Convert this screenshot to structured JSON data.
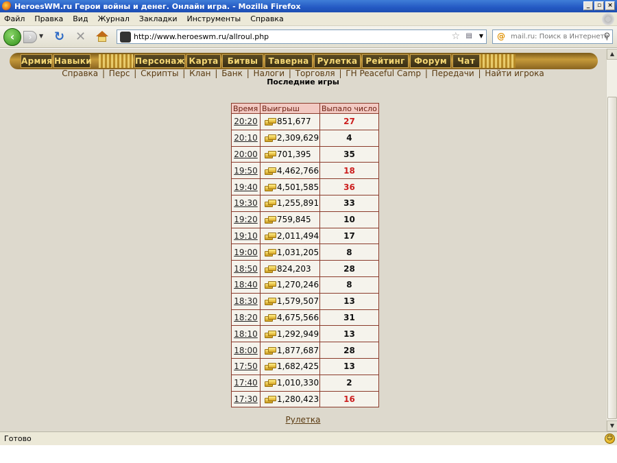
{
  "window": {
    "title": "HeroesWM.ru Герои войны и денег. Онлайн игра. - Mozilla Firefox",
    "buttons": [
      "_",
      "▫",
      "×"
    ]
  },
  "menubar": [
    "Файл",
    "Правка",
    "Вид",
    "Журнал",
    "Закладки",
    "Инструменты",
    "Справка"
  ],
  "toolbar": {
    "url": "http://www.heroeswm.ru/allroul.php",
    "search_placeholder": "mail.ru: Поиск в Интернете"
  },
  "game_menu": {
    "side_buttons": [
      "Армия",
      "Навыки"
    ],
    "main_buttons": [
      "Персонаж",
      "Карта",
      "Битвы",
      "Таверна",
      "Рулетка",
      "Рейтинг",
      "Форум",
      "Чат"
    ]
  },
  "sub_links": [
    "Справка",
    "Перс",
    "Скрипты",
    "Клан",
    "Банк",
    "Налоги",
    "Торговля",
    "ГН Peaceful Camp",
    "Передачи",
    "Найти игрока"
  ],
  "page_title": "Последние игры",
  "table": {
    "headers": [
      "Время",
      "Выигрыш",
      "Выпало число"
    ],
    "rows": [
      {
        "time": "20:20",
        "win": "851,677",
        "number": "27",
        "color": "red"
      },
      {
        "time": "20:10",
        "win": "2,309,629",
        "number": "4",
        "color": "black"
      },
      {
        "time": "20:00",
        "win": "701,395",
        "number": "35",
        "color": "black"
      },
      {
        "time": "19:50",
        "win": "4,462,766",
        "number": "18",
        "color": "red"
      },
      {
        "time": "19:40",
        "win": "4,501,585",
        "number": "36",
        "color": "red"
      },
      {
        "time": "19:30",
        "win": "1,255,891",
        "number": "33",
        "color": "black"
      },
      {
        "time": "19:20",
        "win": "759,845",
        "number": "10",
        "color": "black"
      },
      {
        "time": "19:10",
        "win": "2,011,494",
        "number": "17",
        "color": "black"
      },
      {
        "time": "19:00",
        "win": "1,031,205",
        "number": "8",
        "color": "black"
      },
      {
        "time": "18:50",
        "win": "824,203",
        "number": "28",
        "color": "black"
      },
      {
        "time": "18:40",
        "win": "1,270,246",
        "number": "8",
        "color": "black"
      },
      {
        "time": "18:30",
        "win": "1,579,507",
        "number": "13",
        "color": "black"
      },
      {
        "time": "18:20",
        "win": "4,675,566",
        "number": "31",
        "color": "black"
      },
      {
        "time": "18:10",
        "win": "1,292,949",
        "number": "13",
        "color": "black"
      },
      {
        "time": "18:00",
        "win": "1,877,687",
        "number": "28",
        "color": "black"
      },
      {
        "time": "17:50",
        "win": "1,682,425",
        "number": "13",
        "color": "black"
      },
      {
        "time": "17:40",
        "win": "1,010,330",
        "number": "2",
        "color": "black"
      },
      {
        "time": "17:30",
        "win": "1,280,423",
        "number": "16",
        "color": "red"
      }
    ]
  },
  "footer_link": "Рулетка",
  "status": "Готово",
  "colors": {
    "red_number": "#cc1f1f",
    "black_number": "#111111",
    "header_bg": "#f2c9c2",
    "page_bg": "#ddd9cd"
  }
}
